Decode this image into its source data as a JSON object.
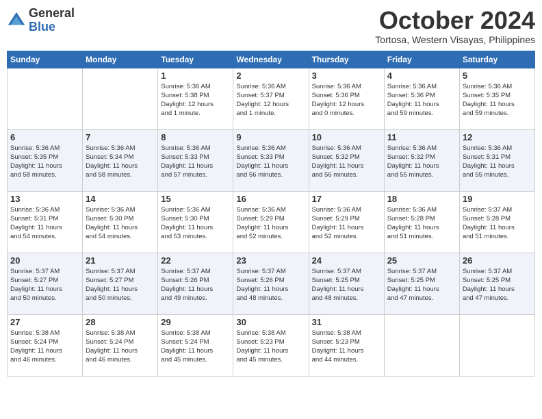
{
  "header": {
    "logo_general": "General",
    "logo_blue": "Blue",
    "month_title": "October 2024",
    "subtitle": "Tortosa, Western Visayas, Philippines"
  },
  "calendar": {
    "days_of_week": [
      "Sunday",
      "Monday",
      "Tuesday",
      "Wednesday",
      "Thursday",
      "Friday",
      "Saturday"
    ],
    "weeks": [
      [
        {
          "day": "",
          "info": ""
        },
        {
          "day": "",
          "info": ""
        },
        {
          "day": "1",
          "info": "Sunrise: 5:36 AM\nSunset: 5:38 PM\nDaylight: 12 hours\nand 1 minute."
        },
        {
          "day": "2",
          "info": "Sunrise: 5:36 AM\nSunset: 5:37 PM\nDaylight: 12 hours\nand 1 minute."
        },
        {
          "day": "3",
          "info": "Sunrise: 5:36 AM\nSunset: 5:36 PM\nDaylight: 12 hours\nand 0 minutes."
        },
        {
          "day": "4",
          "info": "Sunrise: 5:36 AM\nSunset: 5:36 PM\nDaylight: 11 hours\nand 59 minutes."
        },
        {
          "day": "5",
          "info": "Sunrise: 5:36 AM\nSunset: 5:35 PM\nDaylight: 11 hours\nand 59 minutes."
        }
      ],
      [
        {
          "day": "6",
          "info": "Sunrise: 5:36 AM\nSunset: 5:35 PM\nDaylight: 11 hours\nand 58 minutes."
        },
        {
          "day": "7",
          "info": "Sunrise: 5:36 AM\nSunset: 5:34 PM\nDaylight: 11 hours\nand 58 minutes."
        },
        {
          "day": "8",
          "info": "Sunrise: 5:36 AM\nSunset: 5:33 PM\nDaylight: 11 hours\nand 57 minutes."
        },
        {
          "day": "9",
          "info": "Sunrise: 5:36 AM\nSunset: 5:33 PM\nDaylight: 11 hours\nand 56 minutes."
        },
        {
          "day": "10",
          "info": "Sunrise: 5:36 AM\nSunset: 5:32 PM\nDaylight: 11 hours\nand 56 minutes."
        },
        {
          "day": "11",
          "info": "Sunrise: 5:36 AM\nSunset: 5:32 PM\nDaylight: 11 hours\nand 55 minutes."
        },
        {
          "day": "12",
          "info": "Sunrise: 5:36 AM\nSunset: 5:31 PM\nDaylight: 11 hours\nand 55 minutes."
        }
      ],
      [
        {
          "day": "13",
          "info": "Sunrise: 5:36 AM\nSunset: 5:31 PM\nDaylight: 11 hours\nand 54 minutes."
        },
        {
          "day": "14",
          "info": "Sunrise: 5:36 AM\nSunset: 5:30 PM\nDaylight: 11 hours\nand 54 minutes."
        },
        {
          "day": "15",
          "info": "Sunrise: 5:36 AM\nSunset: 5:30 PM\nDaylight: 11 hours\nand 53 minutes."
        },
        {
          "day": "16",
          "info": "Sunrise: 5:36 AM\nSunset: 5:29 PM\nDaylight: 11 hours\nand 52 minutes."
        },
        {
          "day": "17",
          "info": "Sunrise: 5:36 AM\nSunset: 5:29 PM\nDaylight: 11 hours\nand 52 minutes."
        },
        {
          "day": "18",
          "info": "Sunrise: 5:36 AM\nSunset: 5:28 PM\nDaylight: 11 hours\nand 51 minutes."
        },
        {
          "day": "19",
          "info": "Sunrise: 5:37 AM\nSunset: 5:28 PM\nDaylight: 11 hours\nand 51 minutes."
        }
      ],
      [
        {
          "day": "20",
          "info": "Sunrise: 5:37 AM\nSunset: 5:27 PM\nDaylight: 11 hours\nand 50 minutes."
        },
        {
          "day": "21",
          "info": "Sunrise: 5:37 AM\nSunset: 5:27 PM\nDaylight: 11 hours\nand 50 minutes."
        },
        {
          "day": "22",
          "info": "Sunrise: 5:37 AM\nSunset: 5:26 PM\nDaylight: 11 hours\nand 49 minutes."
        },
        {
          "day": "23",
          "info": "Sunrise: 5:37 AM\nSunset: 5:26 PM\nDaylight: 11 hours\nand 48 minutes."
        },
        {
          "day": "24",
          "info": "Sunrise: 5:37 AM\nSunset: 5:25 PM\nDaylight: 11 hours\nand 48 minutes."
        },
        {
          "day": "25",
          "info": "Sunrise: 5:37 AM\nSunset: 5:25 PM\nDaylight: 11 hours\nand 47 minutes."
        },
        {
          "day": "26",
          "info": "Sunrise: 5:37 AM\nSunset: 5:25 PM\nDaylight: 11 hours\nand 47 minutes."
        }
      ],
      [
        {
          "day": "27",
          "info": "Sunrise: 5:38 AM\nSunset: 5:24 PM\nDaylight: 11 hours\nand 46 minutes."
        },
        {
          "day": "28",
          "info": "Sunrise: 5:38 AM\nSunset: 5:24 PM\nDaylight: 11 hours\nand 46 minutes."
        },
        {
          "day": "29",
          "info": "Sunrise: 5:38 AM\nSunset: 5:24 PM\nDaylight: 11 hours\nand 45 minutes."
        },
        {
          "day": "30",
          "info": "Sunrise: 5:38 AM\nSunset: 5:23 PM\nDaylight: 11 hours\nand 45 minutes."
        },
        {
          "day": "31",
          "info": "Sunrise: 5:38 AM\nSunset: 5:23 PM\nDaylight: 11 hours\nand 44 minutes."
        },
        {
          "day": "",
          "info": ""
        },
        {
          "day": "",
          "info": ""
        }
      ]
    ]
  }
}
